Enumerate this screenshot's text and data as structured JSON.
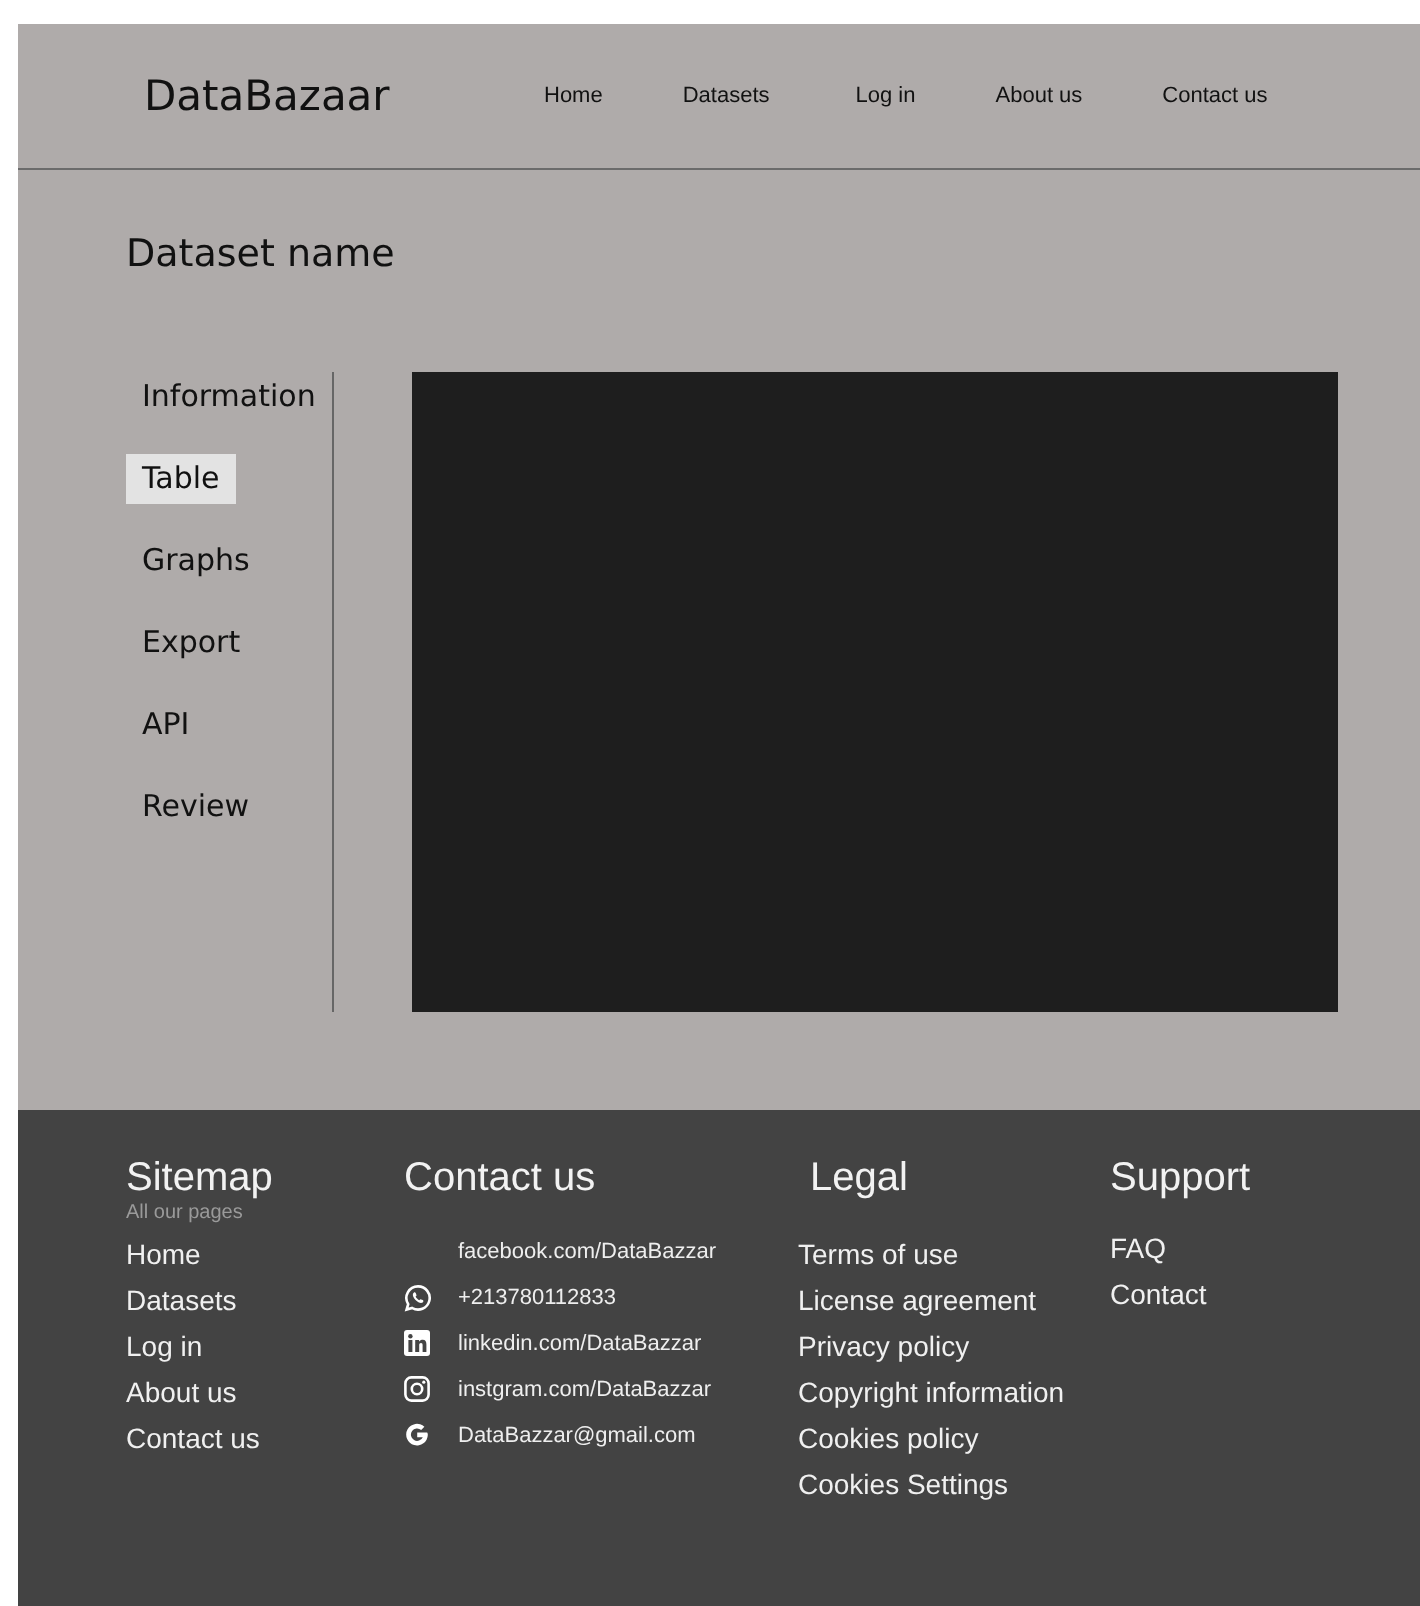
{
  "header": {
    "logo": "DataBazaar",
    "nav": [
      "Home",
      "Datasets",
      "Log in",
      "About us",
      "Contact us"
    ]
  },
  "title": "Dataset name",
  "sidebar": {
    "items": [
      {
        "label": "Information",
        "selected": false
      },
      {
        "label": "Table",
        "selected": true
      },
      {
        "label": "Graphs",
        "selected": false
      },
      {
        "label": "Export",
        "selected": false
      },
      {
        "label": "API",
        "selected": false
      },
      {
        "label": "Review",
        "selected": false
      }
    ]
  },
  "footer": {
    "sitemap": {
      "title": "Sitemap",
      "subtitle": "All our pages",
      "links": [
        "Home",
        "Datasets",
        "Log in",
        "About us",
        "Contact us"
      ]
    },
    "contact": {
      "title": "Contact us",
      "items": [
        {
          "kind": "none",
          "text": "facebook.com/DataBazzar"
        },
        {
          "kind": "phone",
          "text": "+213780112833"
        },
        {
          "kind": "linkedin",
          "text": "linkedin.com/DataBazzar"
        },
        {
          "kind": "instagram",
          "text": "instgram.com/DataBazzar"
        },
        {
          "kind": "google",
          "text": "DataBazzar@gmail.com"
        }
      ]
    },
    "legal": {
      "title": "Legal",
      "links": [
        "Terms of use",
        "License agreement",
        "Privacy policy",
        "Copyright information",
        "Cookies policy",
        "Cookies Settings"
      ]
    },
    "support": {
      "title": "Support",
      "links": [
        "FAQ",
        "Contact"
      ]
    }
  }
}
